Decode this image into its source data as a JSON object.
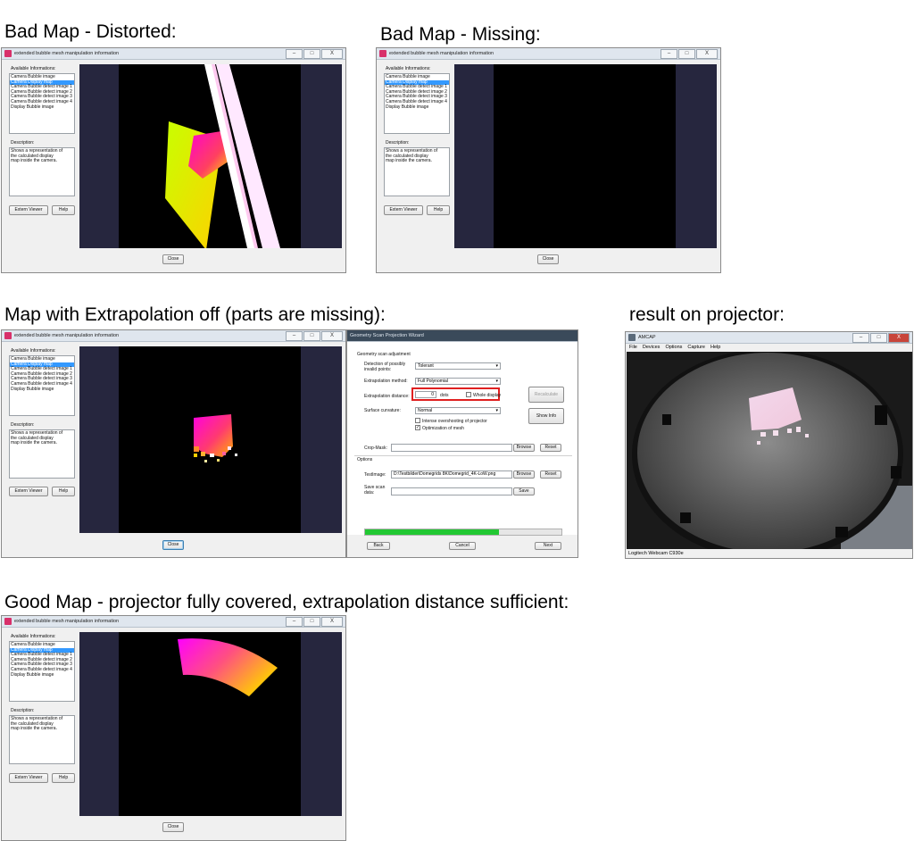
{
  "captions": {
    "distorted": "Bad Map - Distorted:",
    "missing": "Bad Map - Missing:",
    "extrapolation_off": "Map with Extrapolation off (parts are missing):",
    "projector": "result on projector:",
    "good": "Good Map - projector fully covered, extrapolation distance sufficient:"
  },
  "bubble_window": {
    "title": "extended bubble mesh manipulation information",
    "available_label": "Available Informations:",
    "items": [
      "Camera Bubble image",
      "Camera Display map",
      "Camera Bubble detect image 1",
      "Camera Bubble detect image 2",
      "Camera Bubble detect image 3",
      "Camera Bubble detect image 4",
      "Display Bubble image"
    ],
    "description_label": "Description:",
    "description_lines": [
      "Shows a representation of",
      "the calculated display",
      "map inside the camera."
    ],
    "extern_viewer": "Extern Viewer",
    "help": "Help",
    "close": "Close",
    "min_glyph": "‒",
    "max_glyph": "□",
    "close_glyph": "X"
  },
  "geometry_dialog": {
    "title": "Geometry Scan Projection Wizard",
    "section_title": "Geometry scan adjustment",
    "detection_label_1": "Detection of possibly",
    "detection_label_2": "invalid points:",
    "detection_value": "Tolerant",
    "extrapolation_method_label": "Extrapolation method:",
    "extrapolation_method_value": "Full Polynomial",
    "extrapolation_distance_label": "Extrapolation distance:",
    "extrapolation_distance_value": "0",
    "extrapolation_distance_unit": "dots",
    "whole_display": "Whole display",
    "recalculate": "Recalculate",
    "surface_curvature_label": "Surface curvature:",
    "surface_curvature_value": "Normal",
    "show_info": "Show Info",
    "intense_overshooting": "Intense overshooting of projector",
    "optimization": "Optimization of mesh",
    "crop_mask_label": "Crop-Mask:",
    "browse": "Browse",
    "reset": "Reset",
    "options_label": "Options",
    "testimage_label": "TestImage:",
    "testimage_value": "D:\\Testbilder\\Domegrids 8K\\Domegrid_4K-LoW.png",
    "save_scan_label_1": "Save scan",
    "save_scan_label_2": "data:",
    "save": "Save",
    "progress": 0.68,
    "back": "Back",
    "cancel": "Cancel",
    "next": "Next",
    "check_mark": "✓",
    "arrow_glyph": "▾"
  },
  "amcap": {
    "title": "AMCAP",
    "menu": [
      "File",
      "Devices",
      "Options",
      "Capture",
      "Help"
    ],
    "status": "Logitech Webcam C930e"
  },
  "colors": {
    "selection": "#3399ff",
    "progress": "#22c833",
    "viewer_frame": "#26263e",
    "highlight_box": "#e02020"
  }
}
